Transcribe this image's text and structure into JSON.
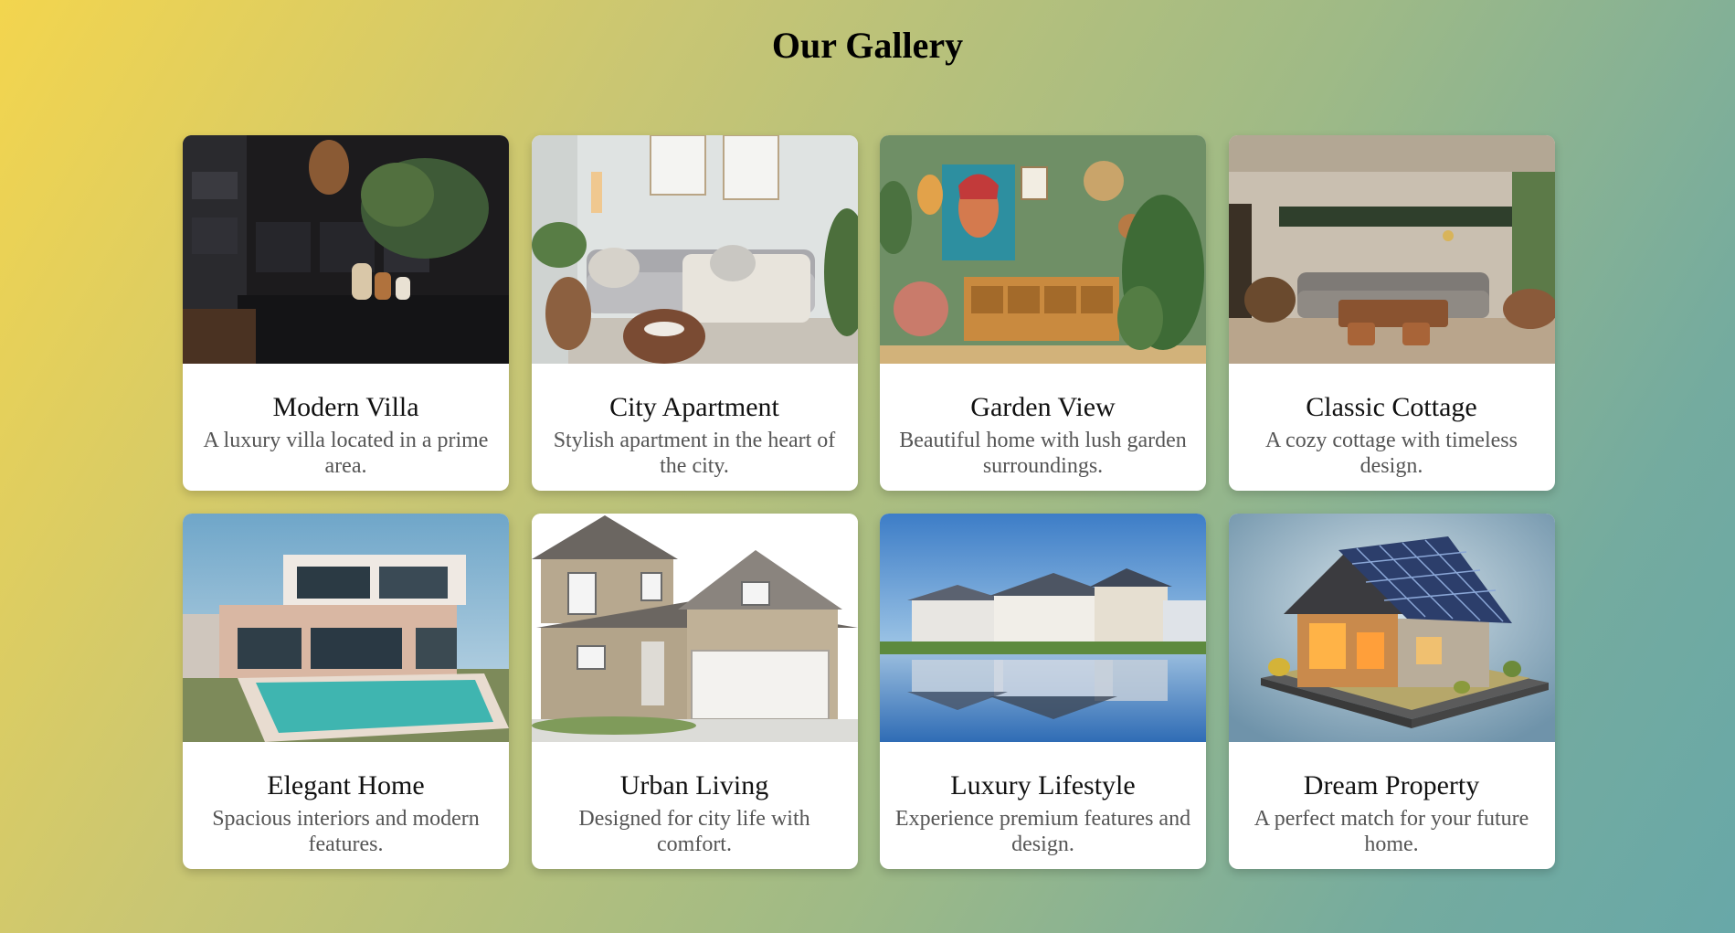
{
  "page": {
    "title": "Our Gallery"
  },
  "gallery": {
    "cards": [
      {
        "title": "Modern Villa",
        "description": "A luxury villa located in a prime area.",
        "image_icon": "kitchen-interior-image"
      },
      {
        "title": "City Apartment",
        "description": "Stylish apartment in the heart of the city.",
        "image_icon": "living-room-image"
      },
      {
        "title": "Garden View",
        "description": "Beautiful home with lush garden surroundings.",
        "image_icon": "green-wall-room-image"
      },
      {
        "title": "Classic Cottage",
        "description": "A cozy cottage with timeless design.",
        "image_icon": "cottage-lounge-image"
      },
      {
        "title": "Elegant Home",
        "description": "Spacious interiors and modern features.",
        "image_icon": "villa-pool-image"
      },
      {
        "title": "Urban Living",
        "description": "Designed for city life with comfort.",
        "image_icon": "suburban-house-image"
      },
      {
        "title": "Luxury Lifestyle",
        "description": "Experience premium features and design.",
        "image_icon": "waterfront-houses-image"
      },
      {
        "title": "Dream Property",
        "description": "A perfect match for your future home.",
        "image_icon": "solar-house-image"
      }
    ]
  },
  "colors": {
    "gradient_start": "#f3d54e",
    "gradient_end": "#68a8a8",
    "card_background": "#ffffff",
    "title_text": "#111111",
    "description_text": "#555555"
  }
}
